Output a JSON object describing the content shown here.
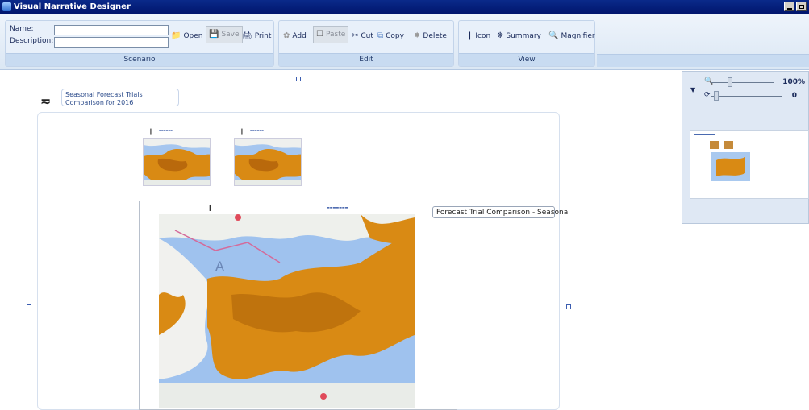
{
  "window": {
    "title": "Visual Narrative Designer",
    "buttons": [
      "minimize-icon",
      "maximize-icon"
    ]
  },
  "ribbon": {
    "scenario": {
      "footer": "Scenario",
      "name_label": "Name:",
      "description_label": "Description:",
      "name_value": "",
      "description_value": "",
      "open_label": "Open",
      "save_label": "Save",
      "print_label": "Print"
    },
    "edit": {
      "footer": "Edit",
      "add_label": "Add",
      "paste_label": "Paste",
      "cut_label": "Cut",
      "copy_label": "Copy",
      "delete_label": "Delete"
    },
    "view": {
      "footer": "View",
      "icon_label": "Icon",
      "summary_label": "Summary",
      "magnifier_label": "Magnifier"
    }
  },
  "canvas": {
    "narrative_title": "Seasonal Forecast Trials Comparison for 2016",
    "callout": "Forecast Trial Comparison - Seasonal"
  },
  "overview": {
    "zoom": "100%",
    "rotation": "0"
  },
  "colors": {
    "titlebar": "#00146b",
    "map_water": "#9fc2ee",
    "map_overlay": "#d98a14",
    "ribbon": "#dbe7f4"
  }
}
